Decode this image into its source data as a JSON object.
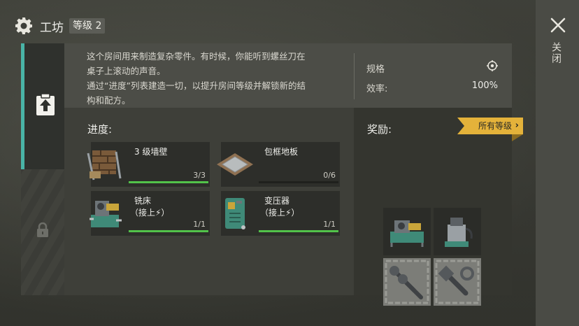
{
  "header": {
    "title": "工坊",
    "level": "等级 2"
  },
  "close": {
    "label": "关闭"
  },
  "info": {
    "description_lines": [
      "这个房间用来制造复杂零件。有时候，你能听到螺丝刀在",
      "桌子上滚动的声音。",
      "通过“进度”列表建造一切，以提升房间等级并解锁新的结",
      "构和配方。"
    ],
    "spec_label": "规格",
    "efficiency_label": "效率:",
    "efficiency_value": "100%"
  },
  "progress": {
    "heading": "进度:",
    "items": [
      {
        "name": "3 级墙壁",
        "sub": "",
        "count": "3/3",
        "fraction": 1.0,
        "icon": "wall-icon"
      },
      {
        "name": "包框地板",
        "sub": "",
        "count": "0/6",
        "fraction": 0.0,
        "icon": "floor-icon"
      },
      {
        "name": "铣床",
        "sub": "（接上⚡）",
        "count": "1/1",
        "fraction": 1.0,
        "icon": "milling-machine-icon"
      },
      {
        "name": "变压器",
        "sub": "（接上⚡）",
        "count": "1/1",
        "fraction": 1.0,
        "icon": "transformer-icon"
      }
    ]
  },
  "reward": {
    "heading": "奖励:",
    "all_levels_label": "所有等级",
    "items": [
      "lathe-machine-icon",
      "welding-machine-icon",
      "screws-icon",
      "bolts-icon"
    ]
  },
  "colors": {
    "accent": "#49b3a6",
    "progress": "#52c34a",
    "ribbon": "#e4b23a"
  }
}
